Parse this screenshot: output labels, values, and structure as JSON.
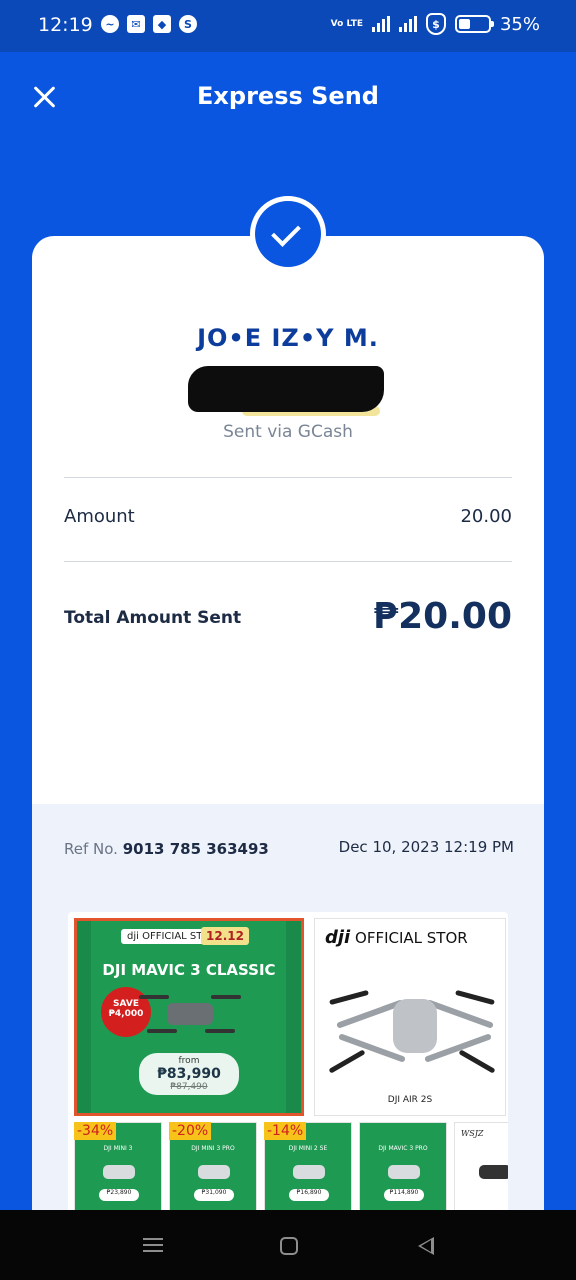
{
  "status_bar": {
    "time": "12:19",
    "left_icons": [
      "messenger-icon",
      "mail-icon",
      "shield-icon",
      "s-icon"
    ],
    "network": "Vo LTE",
    "battery": "35%"
  },
  "header": {
    "title": "Express Send",
    "close_icon": "close-icon"
  },
  "receipt": {
    "status_icon": "check-icon",
    "recipient_name": "JO•E IZ•Y M.",
    "sent_via": "Sent via GCash",
    "amount_label": "Amount",
    "amount_value": "20.00",
    "total_label": "Total Amount Sent",
    "total_value": "₱20.00",
    "ref_label": "Ref No.",
    "ref_number": "9013 785 363493",
    "date": "Dec 10, 2023 12:19 PM"
  },
  "ad": {
    "main": {
      "brand": "dji OFFICIAL STORE",
      "event": "12.12",
      "title": "DJI MAVIC 3 CLASSIC",
      "save": "SAVE ₱4,000",
      "from_label": "from",
      "price": "₱83,990",
      "old_price": "₱87,490"
    },
    "store": {
      "logo": "dji",
      "name": "OFFICIAL STOR",
      "caption": "DJI AIR 2S"
    },
    "thumbnails": [
      {
        "badge": "-34%",
        "title": "DJI MINI 3",
        "price": "₱23,890"
      },
      {
        "badge": "-20%",
        "title": "DJI MINI 3 PRO",
        "price": "₱31,090"
      },
      {
        "badge": "-14%",
        "title": "DJI MINI 2 SE",
        "price": "₱16,890"
      },
      {
        "badge": "",
        "title": "DJI MAVIC 3 PRO",
        "price": "₱114,890"
      },
      {
        "badge": "",
        "title": "WSJZ",
        "price": ""
      }
    ]
  },
  "colors": {
    "primary_blue": "#0a56e0",
    "status_bar_blue": "#0b49b8",
    "navy_text": "#14305e",
    "ad_green": "#1f9a52"
  },
  "system_nav": {
    "icons": [
      "menu-icon",
      "home-icon",
      "back-icon"
    ]
  }
}
